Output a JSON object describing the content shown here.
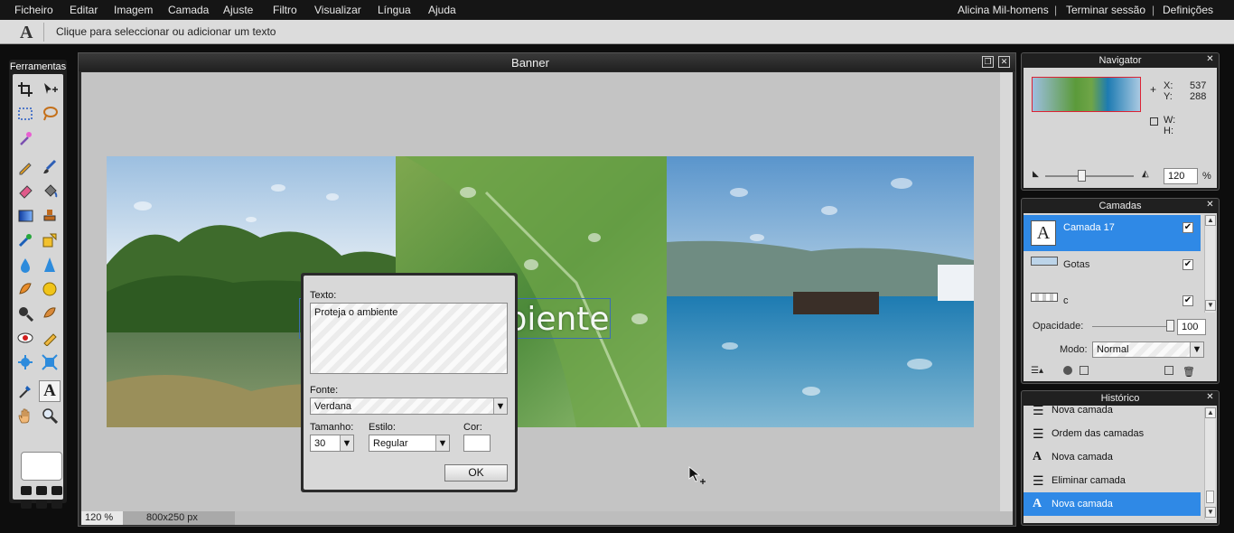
{
  "menubar": {
    "items": [
      "Ficheiro",
      "Editar",
      "Imagem",
      "Camada",
      "Ajuste",
      "Filtro",
      "Visualizar",
      "Língua",
      "Ajuda"
    ],
    "user": "Alicina Mil-homens",
    "logout": "Terminar sessão",
    "settings": "Definições",
    "separator": "|"
  },
  "toolbar": {
    "tool_icon": "text-tool-icon",
    "hint": "Clique para seleccionar ou adicionar um texto"
  },
  "tools_panel": {
    "title": "Ferramentas",
    "tools": [
      "crop-icon",
      "move-icon",
      "marquee-icon",
      "lasso-icon",
      "magic-wand-icon",
      "pencil-icon",
      "brush-icon",
      "eraser-icon",
      "paint-bucket-icon",
      "gradient-icon",
      "clone-stamp-icon",
      "color-replace-icon",
      "draw-shape-icon",
      "blur-icon",
      "sharpen-icon",
      "smudge-icon",
      "sponge-icon",
      "zoom-in-icon",
      "burn-icon",
      "red-eye-icon",
      "spot-heal-icon",
      "bloat-icon",
      "pinch-icon",
      "color-picker-icon",
      "type-icon",
      "hand-icon",
      "zoom-icon"
    ]
  },
  "document": {
    "title": "Banner",
    "banner_text": "Proteja o ambiente",
    "zoom": "120 %",
    "size": "800x250 px"
  },
  "text_dialog": {
    "text_label": "Texto:",
    "text_value": "Proteja o ambiente",
    "font_label": "Fonte:",
    "font_value": "Verdana",
    "size_label": "Tamanho:",
    "size_value": "30",
    "style_label": "Estilo:",
    "style_value": "Regular",
    "color_label": "Cor:",
    "ok_label": "OK"
  },
  "navigator": {
    "title": "Navigator",
    "x_label": "X:",
    "x_value": "537",
    "y_label": "Y:",
    "y_value": "288",
    "w_label": "W:",
    "h_label": "H:",
    "zoom_value": "120",
    "zoom_unit": "%"
  },
  "layers": {
    "title": "Camadas",
    "items": [
      {
        "name": "Camada 17",
        "visible": "✔"
      },
      {
        "name": "Gotas",
        "visible": "✔"
      },
      {
        "name": "c",
        "visible": "✔"
      }
    ],
    "opacity_label": "Opacidade:",
    "opacity_value": "100",
    "mode_label": "Modo:",
    "mode_value": "Normal"
  },
  "history": {
    "title": "Histórico",
    "items": [
      {
        "label": "Nova camada",
        "icon": "layer-icon"
      },
      {
        "label": "Ordem das camadas",
        "icon": "layer-icon"
      },
      {
        "label": "Nova camada",
        "icon": "type-icon"
      },
      {
        "label": "Eliminar camada",
        "icon": "layer-icon"
      },
      {
        "label": "Nova camada",
        "icon": "type-icon"
      }
    ]
  },
  "colors": {
    "selection": "#2f89e6",
    "menubar": "#151515",
    "panel_bg": "#d6d6d6"
  }
}
